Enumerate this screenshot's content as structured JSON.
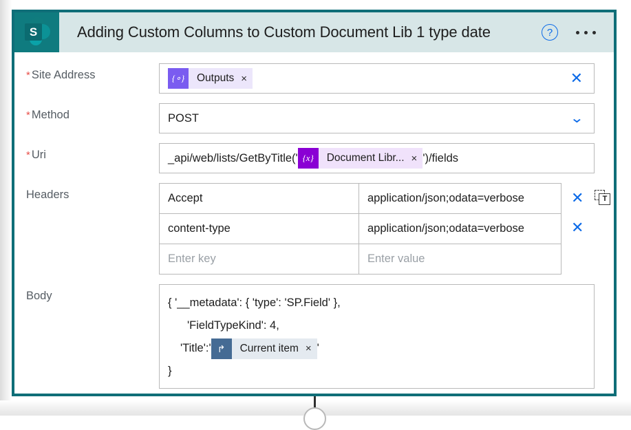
{
  "header": {
    "logo_icon": "sharepoint-logo",
    "logo_letter": "S",
    "title": "Adding Custom Columns to Custom Document Lib 1 type date",
    "help_icon": "help-circle-icon",
    "help_label": "?",
    "more_icon": "more-ellipsis-icon"
  },
  "colors": {
    "card_border": "#0f6e78",
    "header_band": "#d7e6e7",
    "logo_bg": "#0f7b7f",
    "accent_blue": "#0b6ae8",
    "required_red": "#e8504a",
    "token_outputs": "#7a5cf0",
    "token_uri": "#8a00d4",
    "token_current_item": "#456b94"
  },
  "fields": {
    "site_address": {
      "label": "Site Address",
      "required_mark": "*",
      "token": {
        "glyph": "{∘}",
        "text": "Outputs",
        "remove": "×"
      },
      "clear_icon": "clear-x-icon",
      "clear_label": "✕"
    },
    "method": {
      "label": "Method",
      "required_mark": "*",
      "value": "POST",
      "dropdown_icon": "chevron-down-icon",
      "dropdown_label": "⌄",
      "options": [
        "POST"
      ]
    },
    "uri": {
      "label": "Uri",
      "required_mark": "*",
      "prefix": "_api/web/lists/GetByTitle('",
      "token": {
        "glyph": "{x}",
        "text": "Document Libr...",
        "remove": "×"
      },
      "suffix": "')/fields"
    },
    "headers": {
      "label": "Headers",
      "columns": [
        "key",
        "value"
      ],
      "rows": [
        {
          "key": "Accept",
          "value": "application/json;odata=verbose",
          "remove_icon": "clear-x-icon",
          "remove_label": "✕"
        },
        {
          "key": "content-type",
          "value": "application/json;odata=verbose",
          "remove_icon": "clear-x-icon",
          "remove_label": "✕"
        }
      ],
      "placeholder_row": {
        "key": "Enter key",
        "value": "Enter value"
      },
      "text_mode_icon": "switch-to-text-mode-icon",
      "text_mode_letter": "T"
    },
    "body": {
      "label": "Body",
      "line1": "{ '__metadata': { 'type': 'SP.Field' },",
      "line2": "'FieldTypeKind': 4,",
      "line3_prefix": "'Title':'",
      "token": {
        "glyph": "↱",
        "text": "Current item",
        "remove": "×"
      },
      "line3_suffix": "'",
      "line4": "}"
    }
  }
}
